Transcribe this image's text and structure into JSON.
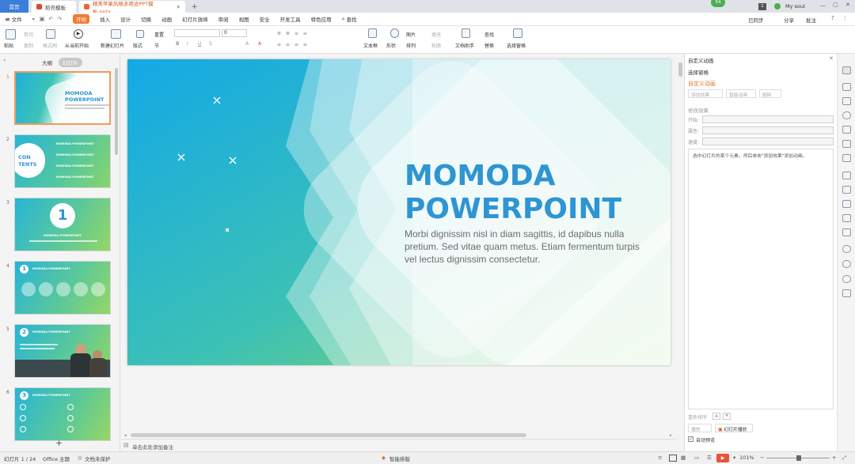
{
  "titlebar": {
    "home_tab": "首页",
    "tab2": "稻壳模板",
    "tab3": "精美苹果风格多用途PPT模板.pptx",
    "new_tab": "+",
    "badge": "54",
    "page_box": "1",
    "user": "My soul"
  },
  "menubar": {
    "file": "文件",
    "items": [
      "开始",
      "插入",
      "设计",
      "切换",
      "动画",
      "幻灯片放映",
      "审阅",
      "视图",
      "安全",
      "开发工具",
      "特色应用"
    ],
    "search": "查找",
    "sync": "已同步",
    "share": "分享",
    "annotate": "批注"
  },
  "toolbar": {
    "paste": "粘贴",
    "cut": "剪切",
    "copy": "复制",
    "format_painter": "格式刷",
    "play_from_current": "从当前开始",
    "new_slide": "新建幻灯片",
    "layout": "版式",
    "reset": "重置",
    "section": "节",
    "font_size": "0",
    "textbox": "文本框",
    "shape": "形状",
    "picture": "图片",
    "arrange": "排列",
    "fill": "填充",
    "outline": "轮廓",
    "doc_assistant": "文档助手",
    "find": "查找",
    "replace": "替换",
    "select_pane": "选择窗格"
  },
  "leftpanel": {
    "tab_outline": "大纲",
    "tab_slides": "幻灯片",
    "thumbs": [
      {
        "num": "1",
        "title": "MOMODA\nPOWERPOINT"
      },
      {
        "num": "2",
        "title": "CON\nTENTS",
        "row": "MOMODA POWERPOINT"
      },
      {
        "num": "3",
        "title": "1",
        "row": "MOMODA POWERPOINT"
      },
      {
        "num": "4",
        "title": "1",
        "row": "MOMODA POWERPOINT"
      },
      {
        "num": "5",
        "title": "2",
        "row": "MOMODA POWERPOINT"
      },
      {
        "num": "6",
        "title": "3",
        "row": "MOMODA POWERPOINT"
      }
    ],
    "add": "+"
  },
  "slide": {
    "title_line1": "MOMODA",
    "title_line2": "POWERPOINT",
    "body": "Morbi dignissim nisl in diam sagittis, id dapibus nulla pretium. Sed vitae quam metus. Etiam fermentum turpis vel lectus dignissim consectetur."
  },
  "rightpane": {
    "header": "自定义动画",
    "select_pane": "选择窗格",
    "section_title": "自定义动画",
    "add_effect": "添加效果",
    "smart_anim": "智能动画",
    "delete": "删除",
    "modify_effect": "修改效果",
    "start_label": "开始:",
    "property_label": "属性:",
    "speed_label": "速度:",
    "hint": "选中幻灯片的某个元素，然后单击\"添加效果\"添加动画。",
    "reorder": "重新排序",
    "play": "播放",
    "slideshow": "幻灯片播放",
    "auto_preview": "自动预览"
  },
  "notes": {
    "placeholder": "单击此处添加备注"
  },
  "statusbar": {
    "slide_count": "幻灯片 1 / 24",
    "theme": "Office 主题",
    "protect": "文档未保护",
    "smart_layout": "智能排版",
    "zoom": "101%",
    "zoom_minus": "−",
    "zoom_plus": "+"
  },
  "colors": {
    "accent": "#f27a31",
    "title_blue": "#2e95d3",
    "teal": "#34b4c9",
    "green": "#7ccf6b"
  }
}
